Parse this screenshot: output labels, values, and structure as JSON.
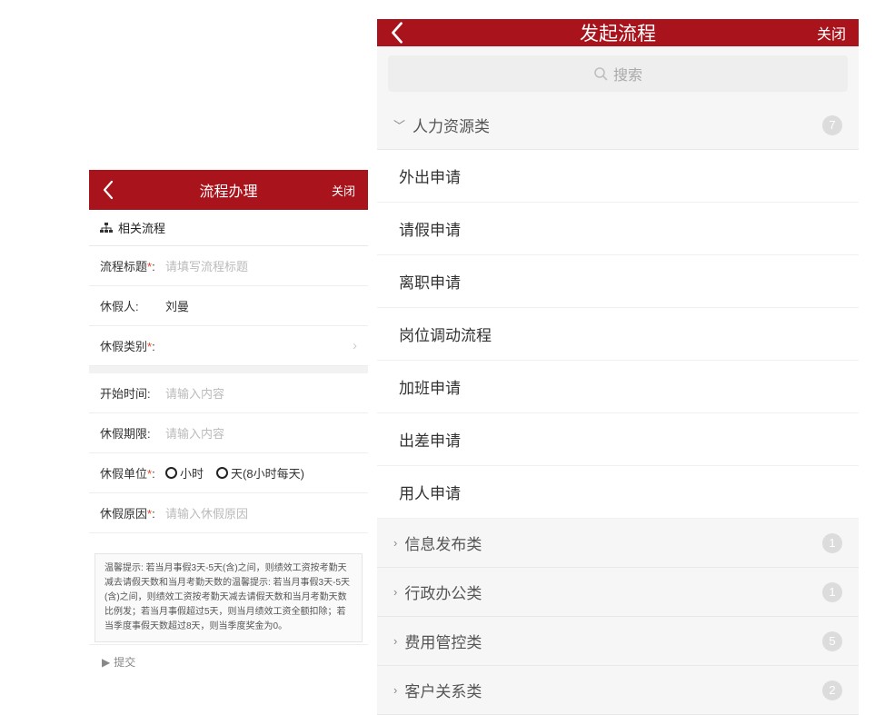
{
  "left": {
    "header": {
      "title": "流程办理",
      "close": "关闭"
    },
    "section_title": "相关流程",
    "form": {
      "title_label": "流程标题",
      "title_placeholder": "请填写流程标题",
      "person_label": "休假人:",
      "person_value": "刘曼",
      "type_label": "休假类别",
      "start_label": "开始时间:",
      "start_placeholder": "请输入内容",
      "duration_label": "休假期限:",
      "duration_placeholder": "请输入内容",
      "unit_label": "休假单位",
      "unit_option1": "小时",
      "unit_option2": "天(8小时每天)",
      "reason_label": "休假原因",
      "reason_placeholder": "请输入休假原因"
    },
    "tip": "温馨提示: 若当月事假3天-5天(含)之间，则绩效工资按考勤天减去请假天数和当月考勤天数的温馨提示: 若当月事假3天-5天(含)之间，则绩效工资按考勤天减去请假天数和当月考勤天数比例发；若当月事假超过5天，则当月绩效工资全额扣除；若当季度事假天数超过8天，则当季度奖金为0。",
    "submit": "提交"
  },
  "right": {
    "header": {
      "title": "发起流程",
      "close": "关闭"
    },
    "search_placeholder": "搜索",
    "expanded_category": {
      "label": "人力资源类",
      "count": "7"
    },
    "items": [
      {
        "label": "外出申请"
      },
      {
        "label": "请假申请"
      },
      {
        "label": "离职申请"
      },
      {
        "label": "岗位调动流程"
      },
      {
        "label": "加班申请"
      },
      {
        "label": "出差申请"
      },
      {
        "label": "用人申请"
      }
    ],
    "collapsed_categories": [
      {
        "label": "信息发布类",
        "count": "1"
      },
      {
        "label": "行政办公类",
        "count": "1"
      },
      {
        "label": "费用管控类",
        "count": "5"
      },
      {
        "label": "客户关系类",
        "count": "2"
      }
    ]
  }
}
